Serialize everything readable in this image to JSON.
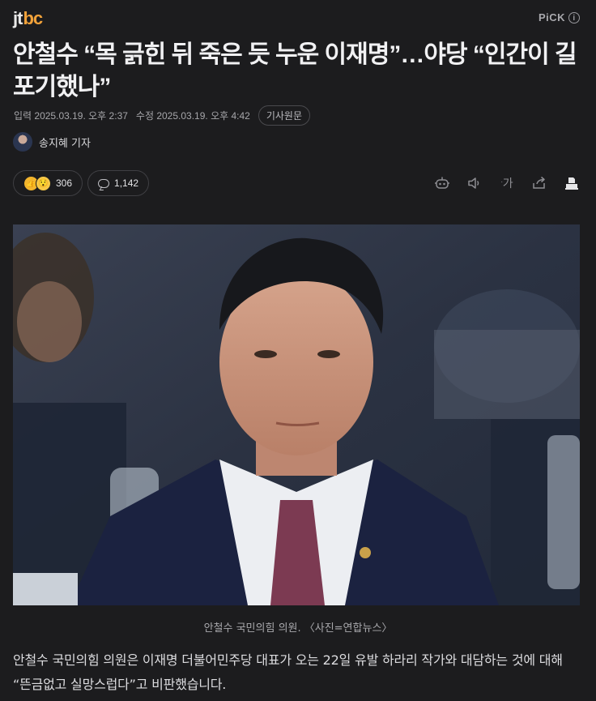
{
  "header": {
    "logo_prefix": "jt",
    "logo_accent": "bc",
    "pick_label": "PiCK",
    "pick_info_icon": "info-icon"
  },
  "article": {
    "title": "안철수 “목 긁힌 뒤 죽은 듯 누운 이재명”…야당 “인간이 길 포기했나”",
    "input_date": "입력 2025.03.19. 오후 2:37",
    "modified_date": "수정 2025.03.19. 오후 4:42",
    "source_button": "기사원문",
    "reporter": "송지혜 기자",
    "reaction_count": "306",
    "comment_count": "1,142",
    "photo_caption": "안철수 국민의힘 의원. 〈사진=연합뉴스〉",
    "body": "안철수 국민의힘 의원은 이재명 더불어민주당 대표가 오는 22일 유발 하라리 작가와 대담하는 것에 대해 “뜬금없고 실망스럽다”고 비판했습니다.",
    "font_size_label": "가"
  },
  "icons": {
    "reaction": "reaction-emoji-icon",
    "comment": "comment-bubble-icon",
    "summary": "robot-summary-icon",
    "audio": "speaker-icon",
    "font_size": "font-size-icon",
    "share": "share-icon",
    "print": "print-icon"
  },
  "colors": {
    "background": "#1c1c1e",
    "logo_accent": "#f2a23a",
    "text_primary": "#f1f1f3",
    "text_secondary": "#a6a6aa"
  }
}
